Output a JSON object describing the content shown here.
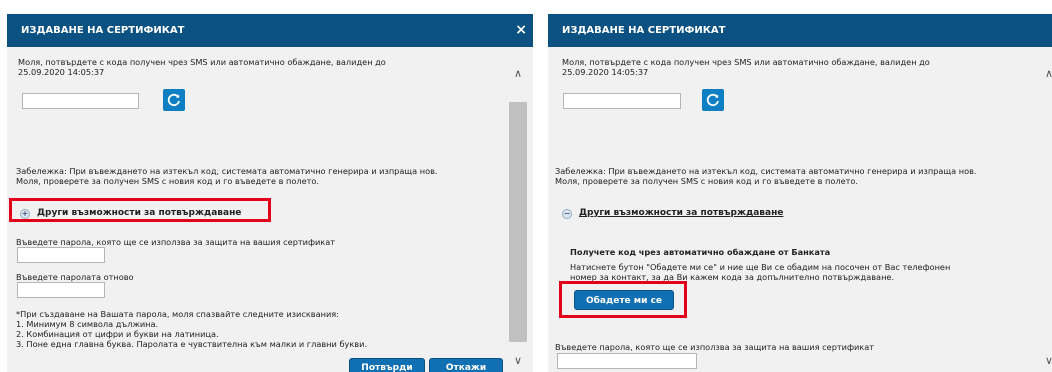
{
  "dialog_title": "ИЗДАВАНЕ НА СЕРТИФИКАТ",
  "close_glyph": "×",
  "sms_prompt_line1": "Моля, потвърдете с кода получен чрез SMS или автоматично обаждане, валиден до",
  "sms_prompt_line2": "25.09.2020 14:05:37",
  "note_line1": "Забележка: При въвеждането на изтекъл код, системата автоматично генерира и изпраща нов.",
  "note_line2": "Моля, проверете за получен SMS с новия код и го въведете в полето.",
  "other_options_label": "Други възможности за потвърждаване",
  "expander_collapsed_glyph": "+",
  "expander_expanded_glyph": "−",
  "password_label": "Въведете парола, която ще се използва за защита на вашия сертификат",
  "password_repeat_label": "Въведете паролата отново",
  "requirements": {
    "intro": "*При създаване на Вашата парола, моля спазвайте следните изисквания:",
    "r1": "1. Минимум 8 символа дължина.",
    "r2": "2. Комбинация от цифри и букви на латиница.",
    "r3": "3. Поне една главна буква. Паролата е чувствителна към малки и главни букви."
  },
  "confirm_button": "Потвърди",
  "cancel_button": "Откажи",
  "call_section": {
    "title": "Получете код чрез автоматично обаждане от Банката",
    "desc_line1": "Натиснете бутон \"Обадете ми се\" и ние ще Ви се обадим на посочен от Вас телефонен",
    "desc_line2": "номер за контакт, за да Ви кажем кода за допълнително потвърждаване.",
    "call_button": "Обадете ми се"
  },
  "scroll_up_glyph": "∧",
  "scroll_down_glyph": "∨",
  "colors": {
    "header_bg": "#0b5182",
    "button_bg": "#1170b3",
    "refresh_bg": "#0e7fc3",
    "highlight": "#e3001b",
    "body_bg": "#f1f1f1"
  }
}
